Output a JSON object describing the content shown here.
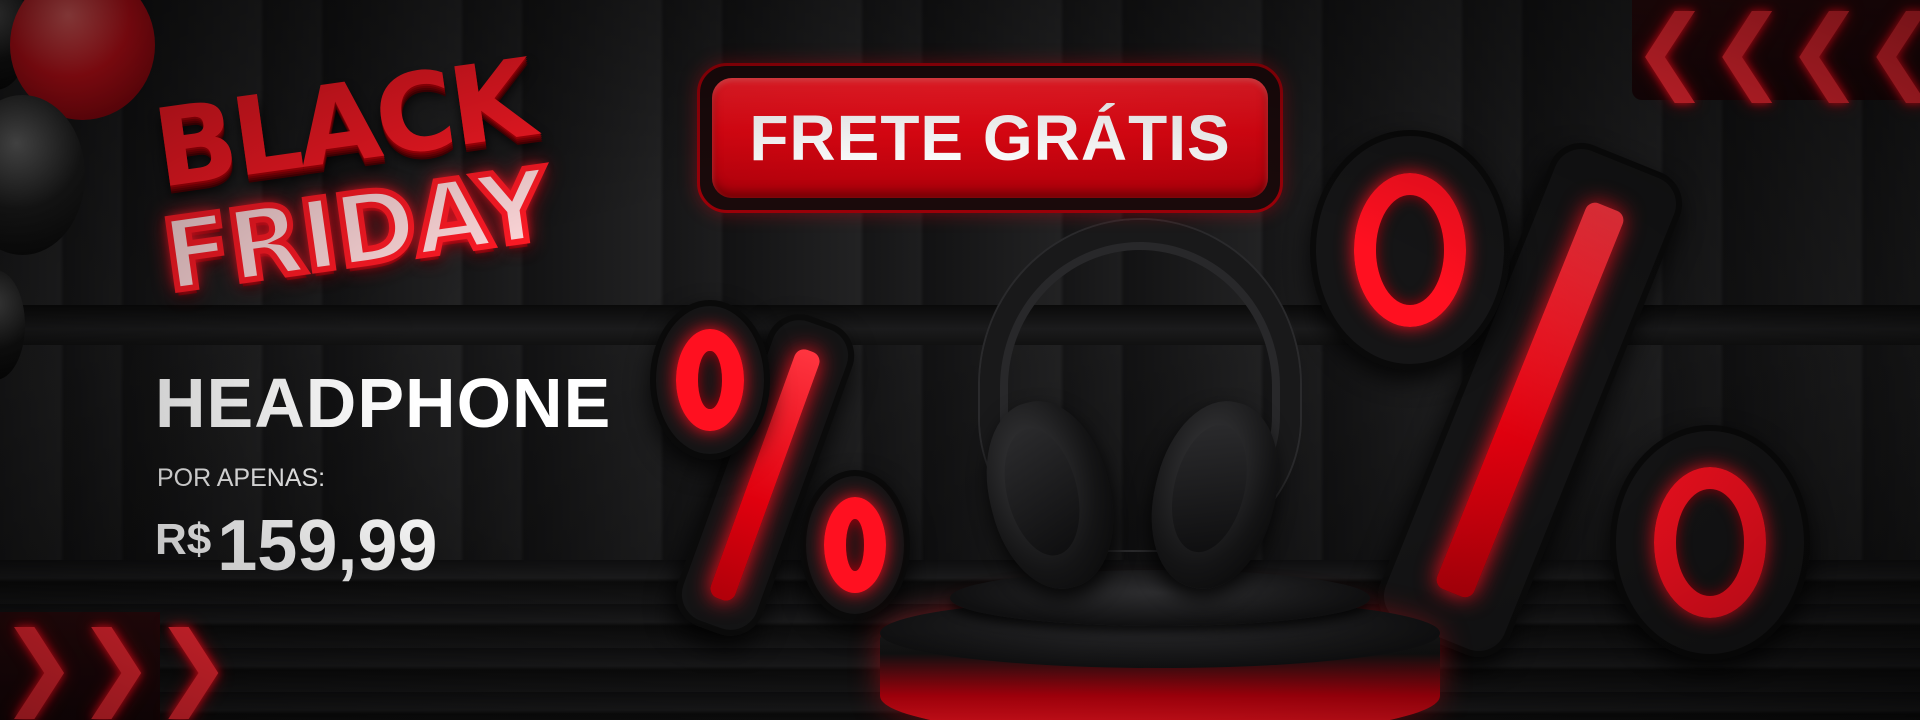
{
  "banner": {
    "event_line1": "BLACK",
    "event_line2": "FRIDAY",
    "shipping_badge": "FRETE GRÁTIS",
    "product_name": "HEADPHONE",
    "price_label": "POR APENAS:",
    "price_currency": "R$",
    "price_value": "159,99"
  },
  "decor": {
    "chevron_glyph": "❮",
    "chevron_glyph_right": "❯",
    "icons": [
      "balloon-red",
      "balloon-black",
      "percent-sign",
      "headphone",
      "podium",
      "chevron-left",
      "chevron-right"
    ]
  },
  "colors": {
    "accent_red": "#ff1a25",
    "dark_red": "#a8000a",
    "background": "#161617",
    "text": "#ffffff"
  }
}
